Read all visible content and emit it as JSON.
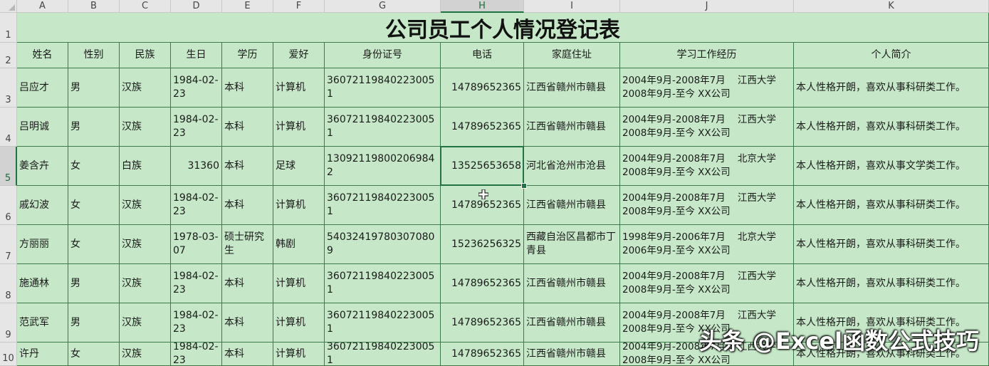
{
  "columns": [
    "A",
    "B",
    "C",
    "D",
    "E",
    "F",
    "G",
    "H",
    "I",
    "J",
    "K"
  ],
  "selected_column": "H",
  "rows": [
    "1",
    "2",
    "3",
    "4",
    "5",
    "6",
    "7",
    "8",
    "9",
    "10"
  ],
  "selected_row": "5",
  "title": "公司员工个人情况登记表",
  "headers": [
    "姓名",
    "性别",
    "民族",
    "生日",
    "学历",
    "爱好",
    "身份证号",
    "电话",
    "家庭住址",
    "学习工作经历",
    "个人简介"
  ],
  "records": [
    [
      "吕应才",
      "男",
      "汉族",
      "1984-02-23",
      "本科",
      "计算机",
      "360721198402230051",
      "14789652365",
      "江西省赣州市赣县",
      "2004年9月-2008年7月    江西大学\n2008年9月-至今 XX公司",
      "本人性格开朗，喜欢从事科研类工作。"
    ],
    [
      "吕明诚",
      "男",
      "汉族",
      "1984-02-23",
      "本科",
      "计算机",
      "360721198402230051",
      "14789652365",
      "江西省赣州市赣县",
      "2004年9月-2008年7月    江西大学\n2008年9月-至今 XX公司",
      "本人性格开朗，喜欢从事科研类工作。"
    ],
    [
      "姜含卉",
      "女",
      "白族",
      "31360",
      "本科",
      "足球",
      "130921198002069842",
      "13525653658",
      "河北省沧州市沧县",
      "2004年9月-2008年7月    北京大学\n2008年9月-至今 XX公司",
      "本人性格开朗，喜欢从事文学类工作。"
    ],
    [
      "戚幻波",
      "女",
      "汉族",
      "1984-02-23",
      "本科",
      "计算机",
      "360721198402230051",
      "14789652365",
      "江西省赣州市赣县",
      "2004年9月-2008年7月    江西大学\n2008年9月-至今 XX公司",
      "本人性格开朗，喜欢从事科研类工作。"
    ],
    [
      "方丽丽",
      "女",
      "汉族",
      "1978-03-07",
      "硕士研究生",
      "韩剧",
      "540324197803070809",
      "15236256325",
      "西藏自治区昌都市丁青县",
      "1998年9月-2006年7月    北京大学\n2006年9月-至今 XX公司",
      "本人性格开朗，喜欢从事科研类工作。"
    ],
    [
      "施通林",
      "男",
      "汉族",
      "1984-02-23",
      "本科",
      "计算机",
      "360721198402230051",
      "14789652365",
      "江西省赣州市赣县",
      "2004年9月-2008年7月    江西大学\n2008年9月-至今 XX公司",
      "本人性格开朗，喜欢从事科研类工作。"
    ],
    [
      "范武军",
      "男",
      "汉族",
      "1984-02-23",
      "本科",
      "计算机",
      "360721198402230051",
      "14789652365",
      "江西省赣州市赣县",
      "2004年9月-2008年7月    江西大学\n2008年9月-至今 XX公司",
      "本人性格开朗，喜欢从事科研类工作。"
    ],
    [
      "许丹",
      "女",
      "汉族",
      "1984-02-23",
      "本科",
      "计算机",
      "360721198402230051",
      "14789652365",
      "江西省赣州市赣县",
      "2004年9月-2008年7月    江西大学\n2008年9月-至今 XX公司",
      "本人性格开朗，喜欢从事科研类工作。"
    ]
  ],
  "numeric_columns": [
    7
  ],
  "active_cell": {
    "row": 2,
    "col": 7
  },
  "watermark": "头条 @Excel函数公式技巧",
  "colors": {
    "cell_fill": "#c6e8c8",
    "grid": "#3d7a4a",
    "selection": "#217346"
  },
  "icons": {
    "cursor": "excel-cross-cursor-icon"
  }
}
